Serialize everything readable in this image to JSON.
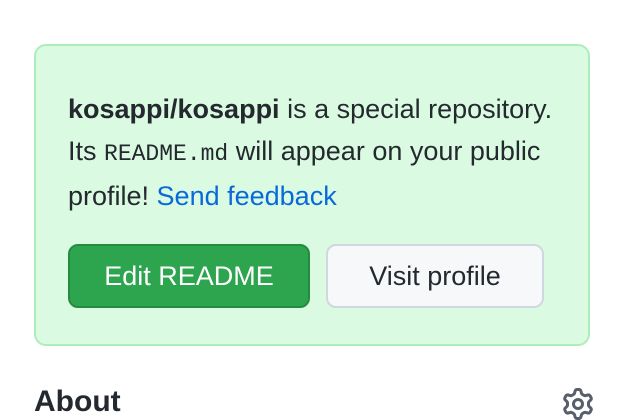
{
  "notice": {
    "repo_name": "kosappi/kosappi",
    "text_1": " is a special repository. Its ",
    "code": "README.md",
    "text_2": " will appear on your public profile! ",
    "feedback_link": "Send feedback",
    "edit_button": "Edit README",
    "visit_button": "Visit profile"
  },
  "about": {
    "heading": "About",
    "settings_icon": "gear-icon"
  },
  "colors": {
    "notice_bg": "#dafbe1",
    "notice_border": "#aceebb",
    "primary_button": "#2da44e",
    "link": "#0969da"
  }
}
